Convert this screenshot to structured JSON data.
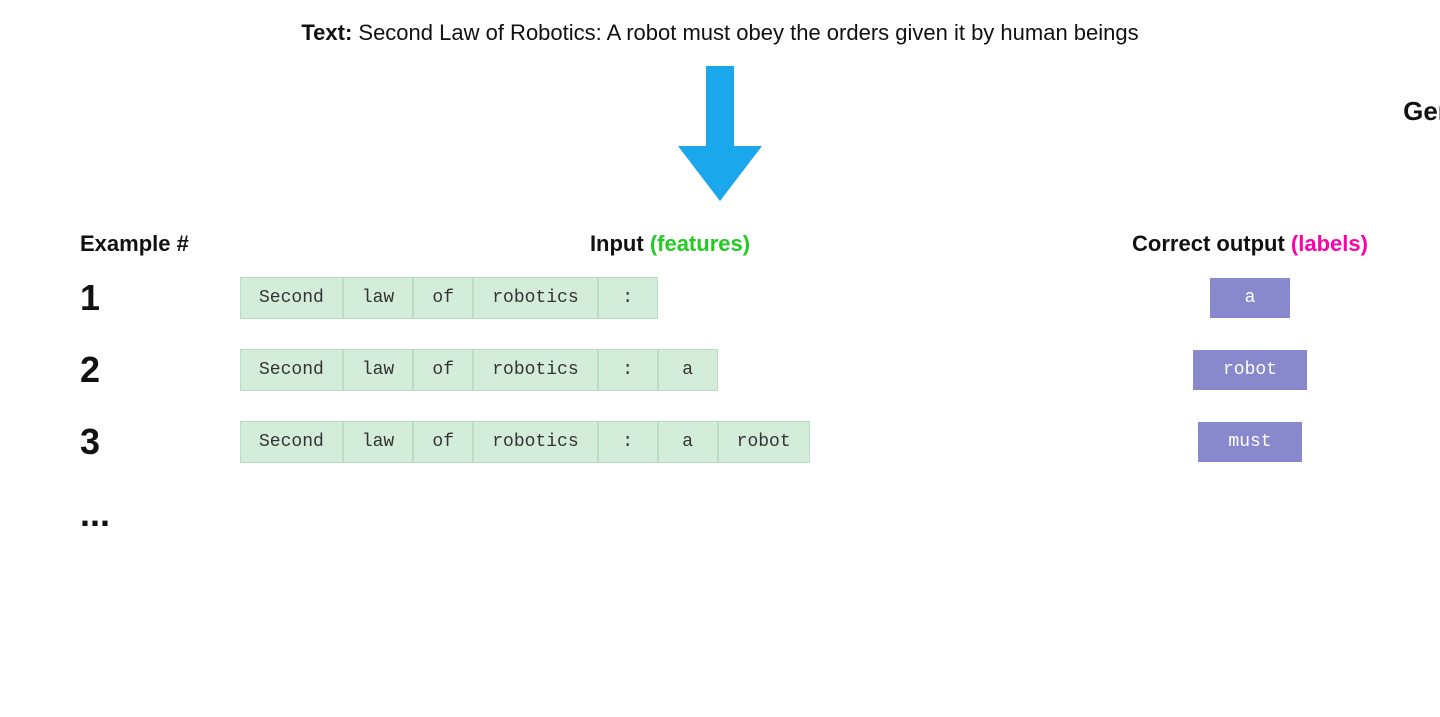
{
  "header": {
    "prefix_bold": "Text:",
    "text": " Second Law of Robotics: A robot must obey the orders given it by human beings"
  },
  "arrow": {
    "label": "Generated training examples",
    "color": "#1aa7ec"
  },
  "columns": {
    "example_header": "Example #",
    "input_header_plain": "Input ",
    "input_header_colored": "(features)",
    "output_header_plain": "Correct output ",
    "output_header_colored": "(labels)"
  },
  "rows": [
    {
      "number": "1",
      "tokens": [
        "Second",
        "law",
        "of",
        "robotics",
        ":"
      ],
      "output": "a"
    },
    {
      "number": "2",
      "tokens": [
        "Second",
        "law",
        "of",
        "robotics",
        ":",
        "a"
      ],
      "output": "robot"
    },
    {
      "number": "3",
      "tokens": [
        "Second",
        "law",
        "of",
        "robotics",
        ":",
        "a",
        "robot"
      ],
      "output": "must"
    }
  ],
  "ellipsis": "..."
}
